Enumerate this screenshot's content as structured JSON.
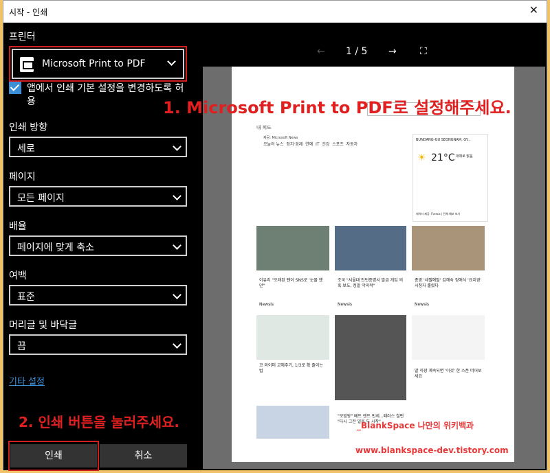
{
  "window": {
    "title": "시작 - 인쇄",
    "close_label": "✕"
  },
  "printer": {
    "label": "프린터",
    "value": "Microsoft Print to PDF"
  },
  "app_settings": {
    "label": "앱에서 인쇄 기본 설정을 변경하도록 허용",
    "checked": true
  },
  "orientation": {
    "label": "인쇄 방향",
    "value": "세로"
  },
  "pages": {
    "label": "페이지",
    "value": "모든 페이지"
  },
  "scale": {
    "label": "배율",
    "value": "페이지에 맞게 축소"
  },
  "margins": {
    "label": "여백",
    "value": "표준"
  },
  "headers": {
    "label": "머리글 및 바닥글",
    "value": "끔"
  },
  "more_settings": "기타 설정",
  "buttons": {
    "print": "인쇄",
    "cancel": "취소"
  },
  "preview_nav": {
    "prev": "←",
    "page": "1 / 5",
    "next": "→",
    "fit": "⛶"
  },
  "annotations": {
    "step1": "1. Microsoft Print to PDF로 설정해주세요.",
    "step2": "2. 인쇄 버튼을 눌러주세요."
  },
  "watermark": {
    "line1": "_BlankSpace 나만의 위키백과",
    "line2": "www.blankspace-dev.tistory.com"
  },
  "preview": {
    "header": "내 피드",
    "news_source": "제공: Microsoft News",
    "tabs": [
      "오늘의 뉴스",
      "정치·경제",
      "연예",
      "IT",
      "건강",
      "스포츠",
      "자동차"
    ],
    "weather_location": "BUNDANG-GU SEONGNAM, GY...",
    "temperature": "21°C",
    "weather_desc": "대체로 맑음",
    "forecast_note": "데이터 제공: Foreca | 전체 예보 보기",
    "tiles": [
      {
        "text": "이유리 \"오래된 팬이 SNS로 '눈물 했던\""
      },
      {
        "text": "조국 \"서울대 인턴증명서 발급 개입 의혹 보도, 정말 악의적\""
      },
      {
        "text": "종영 '세젤예딸' 김해숙 정애식 '요지경' 시청자 홀렸다"
      },
      {
        "text": "코 와이퍼 교체주기, 1/3로 확 줄이는 법"
      },
      {
        "text": "\"모범왕\" 베트 렌트 빈세...패러스 철펀 \"다시 그전 일을 두 시작\""
      },
      {
        "text": "말 직장 계속되면 '이것' 한 스푼 떠어보세요"
      }
    ],
    "source_label": "Newsis"
  }
}
